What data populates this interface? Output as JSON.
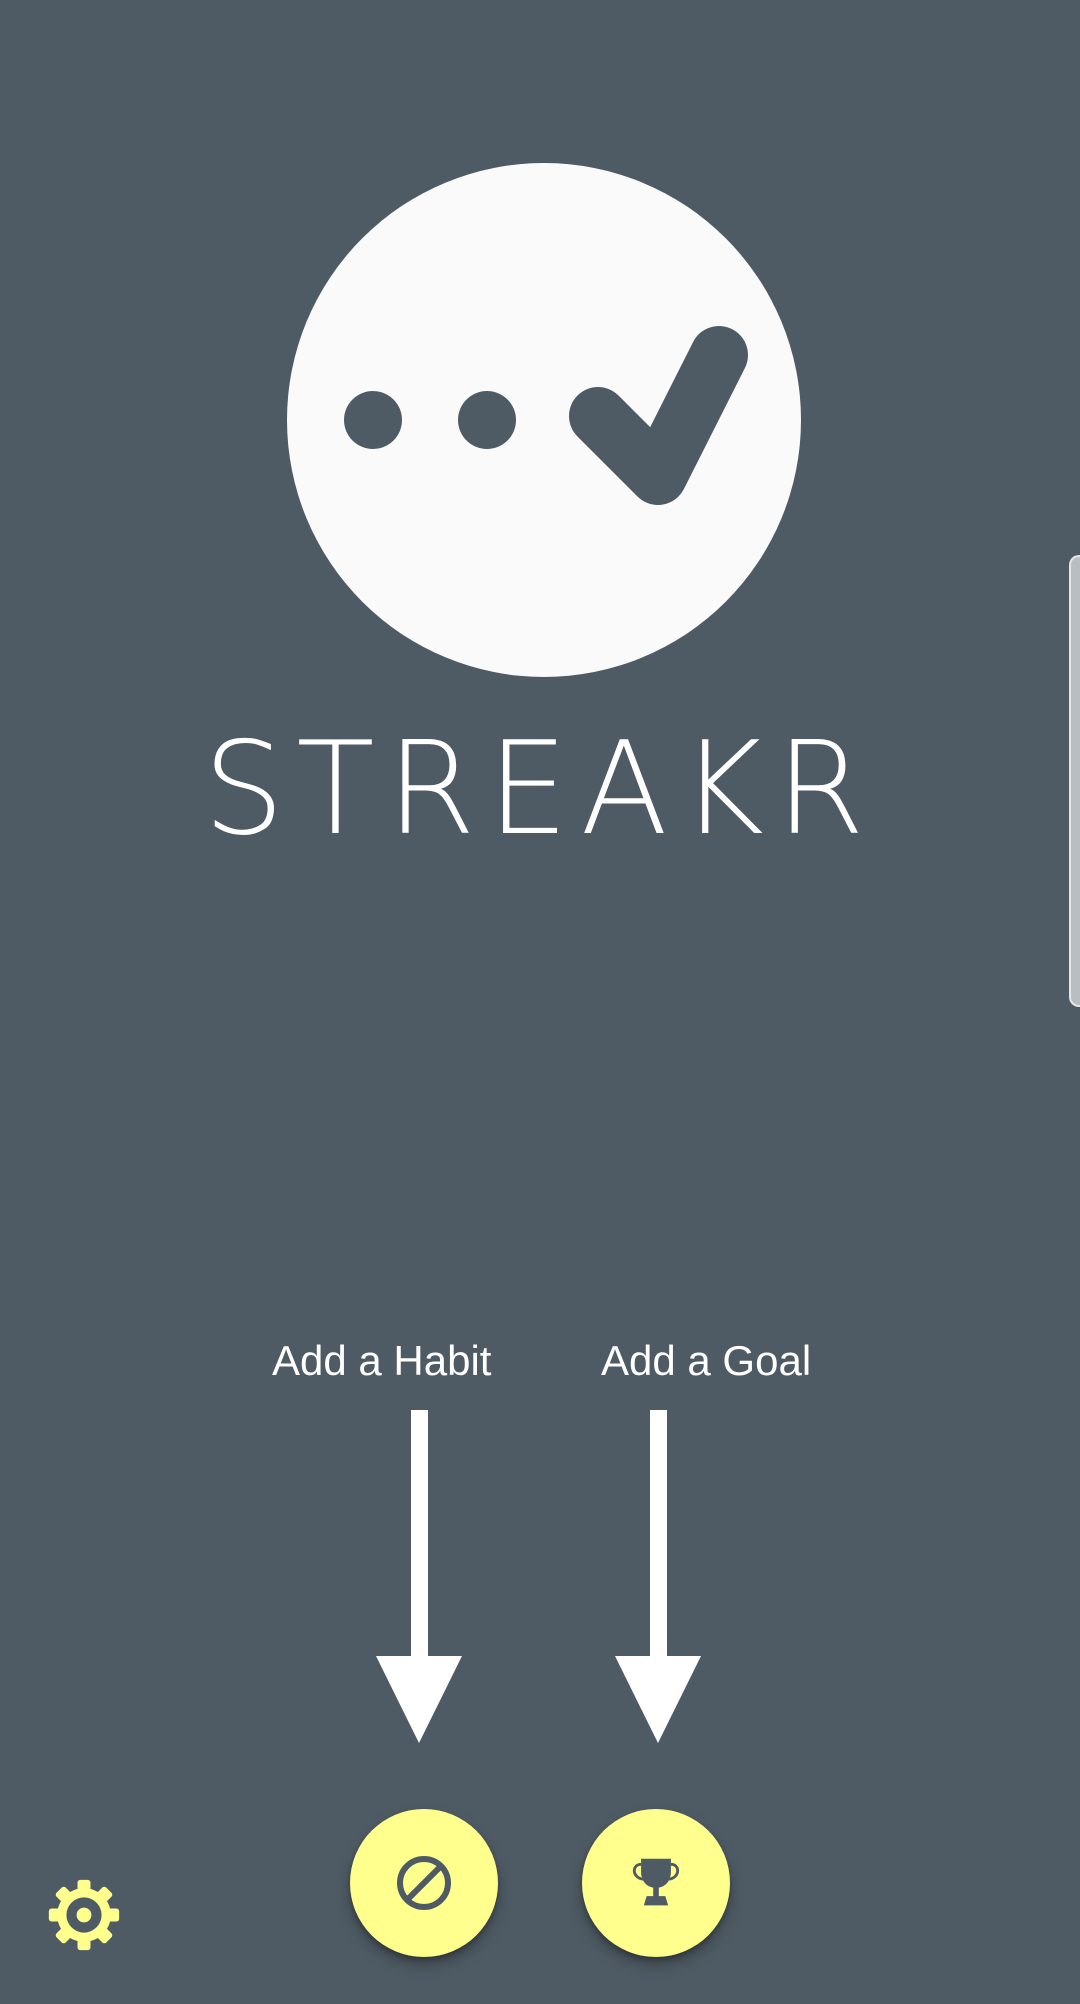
{
  "app": {
    "title": "STREAKR"
  },
  "hints": {
    "habit_label": "Add a Habit",
    "goal_label": "Add a Goal"
  },
  "actions": {
    "add_habit_icon": "block-icon",
    "add_goal_icon": "trophy-icon",
    "settings_icon": "gear-icon"
  },
  "colors": {
    "background": "#4f5b64",
    "logo": "#fafafa",
    "accent": "#ffff8d",
    "text": "#ffffff"
  }
}
